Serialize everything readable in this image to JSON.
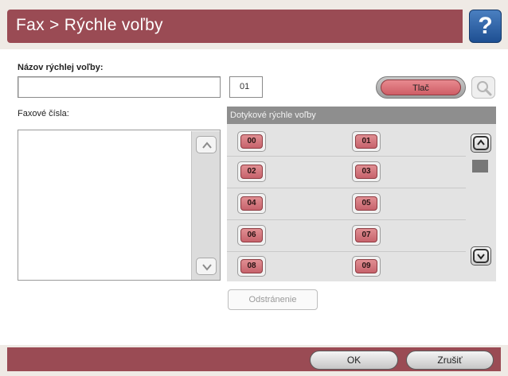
{
  "header": {
    "title": "Fax > Rýchle voľby",
    "help_icon": "question-mark-icon",
    "help_label": "?"
  },
  "form": {
    "name_label": "Názov rýchlej voľby:",
    "name_value": "",
    "number_value": "01",
    "print_label": "Tlač",
    "search_icon": "magnifier-icon",
    "fax_numbers_label": "Faxové čísla:"
  },
  "speed_dials": {
    "header": "Dotykové rýchle voľby",
    "items": [
      "00",
      "01",
      "02",
      "03",
      "04",
      "05",
      "06",
      "07",
      "08",
      "09"
    ]
  },
  "actions": {
    "remove_label": "Odstránenie",
    "ok_label": "OK",
    "cancel_label": "Zrušiť"
  },
  "colors": {
    "accent": "#9a4b54",
    "button_red": "#cf5d66",
    "help_blue": "#2a5ea3"
  }
}
